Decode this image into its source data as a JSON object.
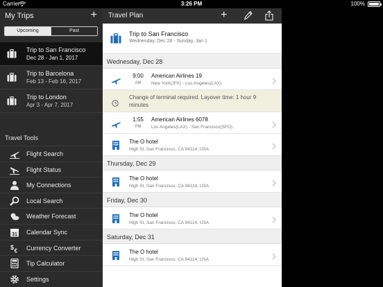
{
  "status": {
    "carrier": "Carrier",
    "time": "3:26 PM",
    "battery": "100%",
    "battery_level": 1.0
  },
  "sidebar": {
    "title": "My Trips",
    "add": "+",
    "segments": [
      "Upcoming",
      "Past"
    ],
    "trips": [
      {
        "name": "Trip to San Francisco",
        "dates": "Dec 28 - Jan 1, 2017",
        "selected": true
      },
      {
        "name": "Trip to Barcelona",
        "dates": "Feb 13 - Feb 16, 2017",
        "selected": false
      },
      {
        "name": "Trip to London",
        "dates": "Apr 3 - Apr 7, 2017",
        "selected": false
      }
    ],
    "tools_title": "Travel Tools",
    "tools": [
      {
        "label": "Flight Search",
        "icon": "plane-up-icon"
      },
      {
        "label": "Flight Status",
        "icon": "plane-down-icon"
      },
      {
        "label": "My Connections",
        "icon": "people-icon"
      },
      {
        "label": "Local Search",
        "icon": "magnifier-icon"
      },
      {
        "label": "Weather Forecast",
        "icon": "weather-icon"
      },
      {
        "label": "Calendar Sync",
        "icon": "calendar-icon"
      },
      {
        "label": "Currency Converter",
        "icon": "currency-icon"
      },
      {
        "label": "Tip Calculator",
        "icon": "calculator-icon"
      },
      {
        "label": "Settings",
        "icon": "gear-icon"
      }
    ],
    "calendar_day": "31"
  },
  "main": {
    "title": "Travel Plan",
    "add": "+",
    "trip": {
      "name": "Trip to San Francisco",
      "dates": "Wednesday, Dec 28 - Sunday, Jan 1"
    },
    "days": [
      {
        "label": "Wednesday, Dec 28",
        "items": [
          {
            "type": "flight",
            "time": "9:00",
            "ampm": "AM",
            "title": "American Airlines 19",
            "subtitle": "New York(JFK) - Los Angeles(LAX)"
          },
          {
            "type": "note",
            "text": "Change of terminal required. Layover time: 1 hour 9 minutes"
          },
          {
            "type": "flight",
            "time": "1:55",
            "ampm": "PM",
            "title": "American Airlines 6078",
            "subtitle": "Los Angeles(LAX) - San Francisco(SFO)"
          },
          {
            "type": "hotel",
            "title": "The O hotel",
            "subtitle": "High St, San Francisco, CA 94114, USA"
          }
        ]
      },
      {
        "label": "Thursday, Dec 29",
        "items": [
          {
            "type": "hotel",
            "title": "The O hotel",
            "subtitle": "High St, San Francisco, CA 94114, USA"
          }
        ]
      },
      {
        "label": "Friday, Dec 30",
        "items": [
          {
            "type": "hotel",
            "title": "The O hotel",
            "subtitle": "High St, San Francisco, CA 94114, USA"
          }
        ]
      },
      {
        "label": "Saturday, Dec 31",
        "items": [
          {
            "type": "hotel",
            "title": "The O hotel",
            "subtitle": "High St, San Francisco, CA 94114, USA"
          }
        ]
      }
    ]
  },
  "colors": {
    "accent": "#1e6fb8",
    "sidebar_bg": "#2b2b2b",
    "note_bg": "#f1efde"
  }
}
